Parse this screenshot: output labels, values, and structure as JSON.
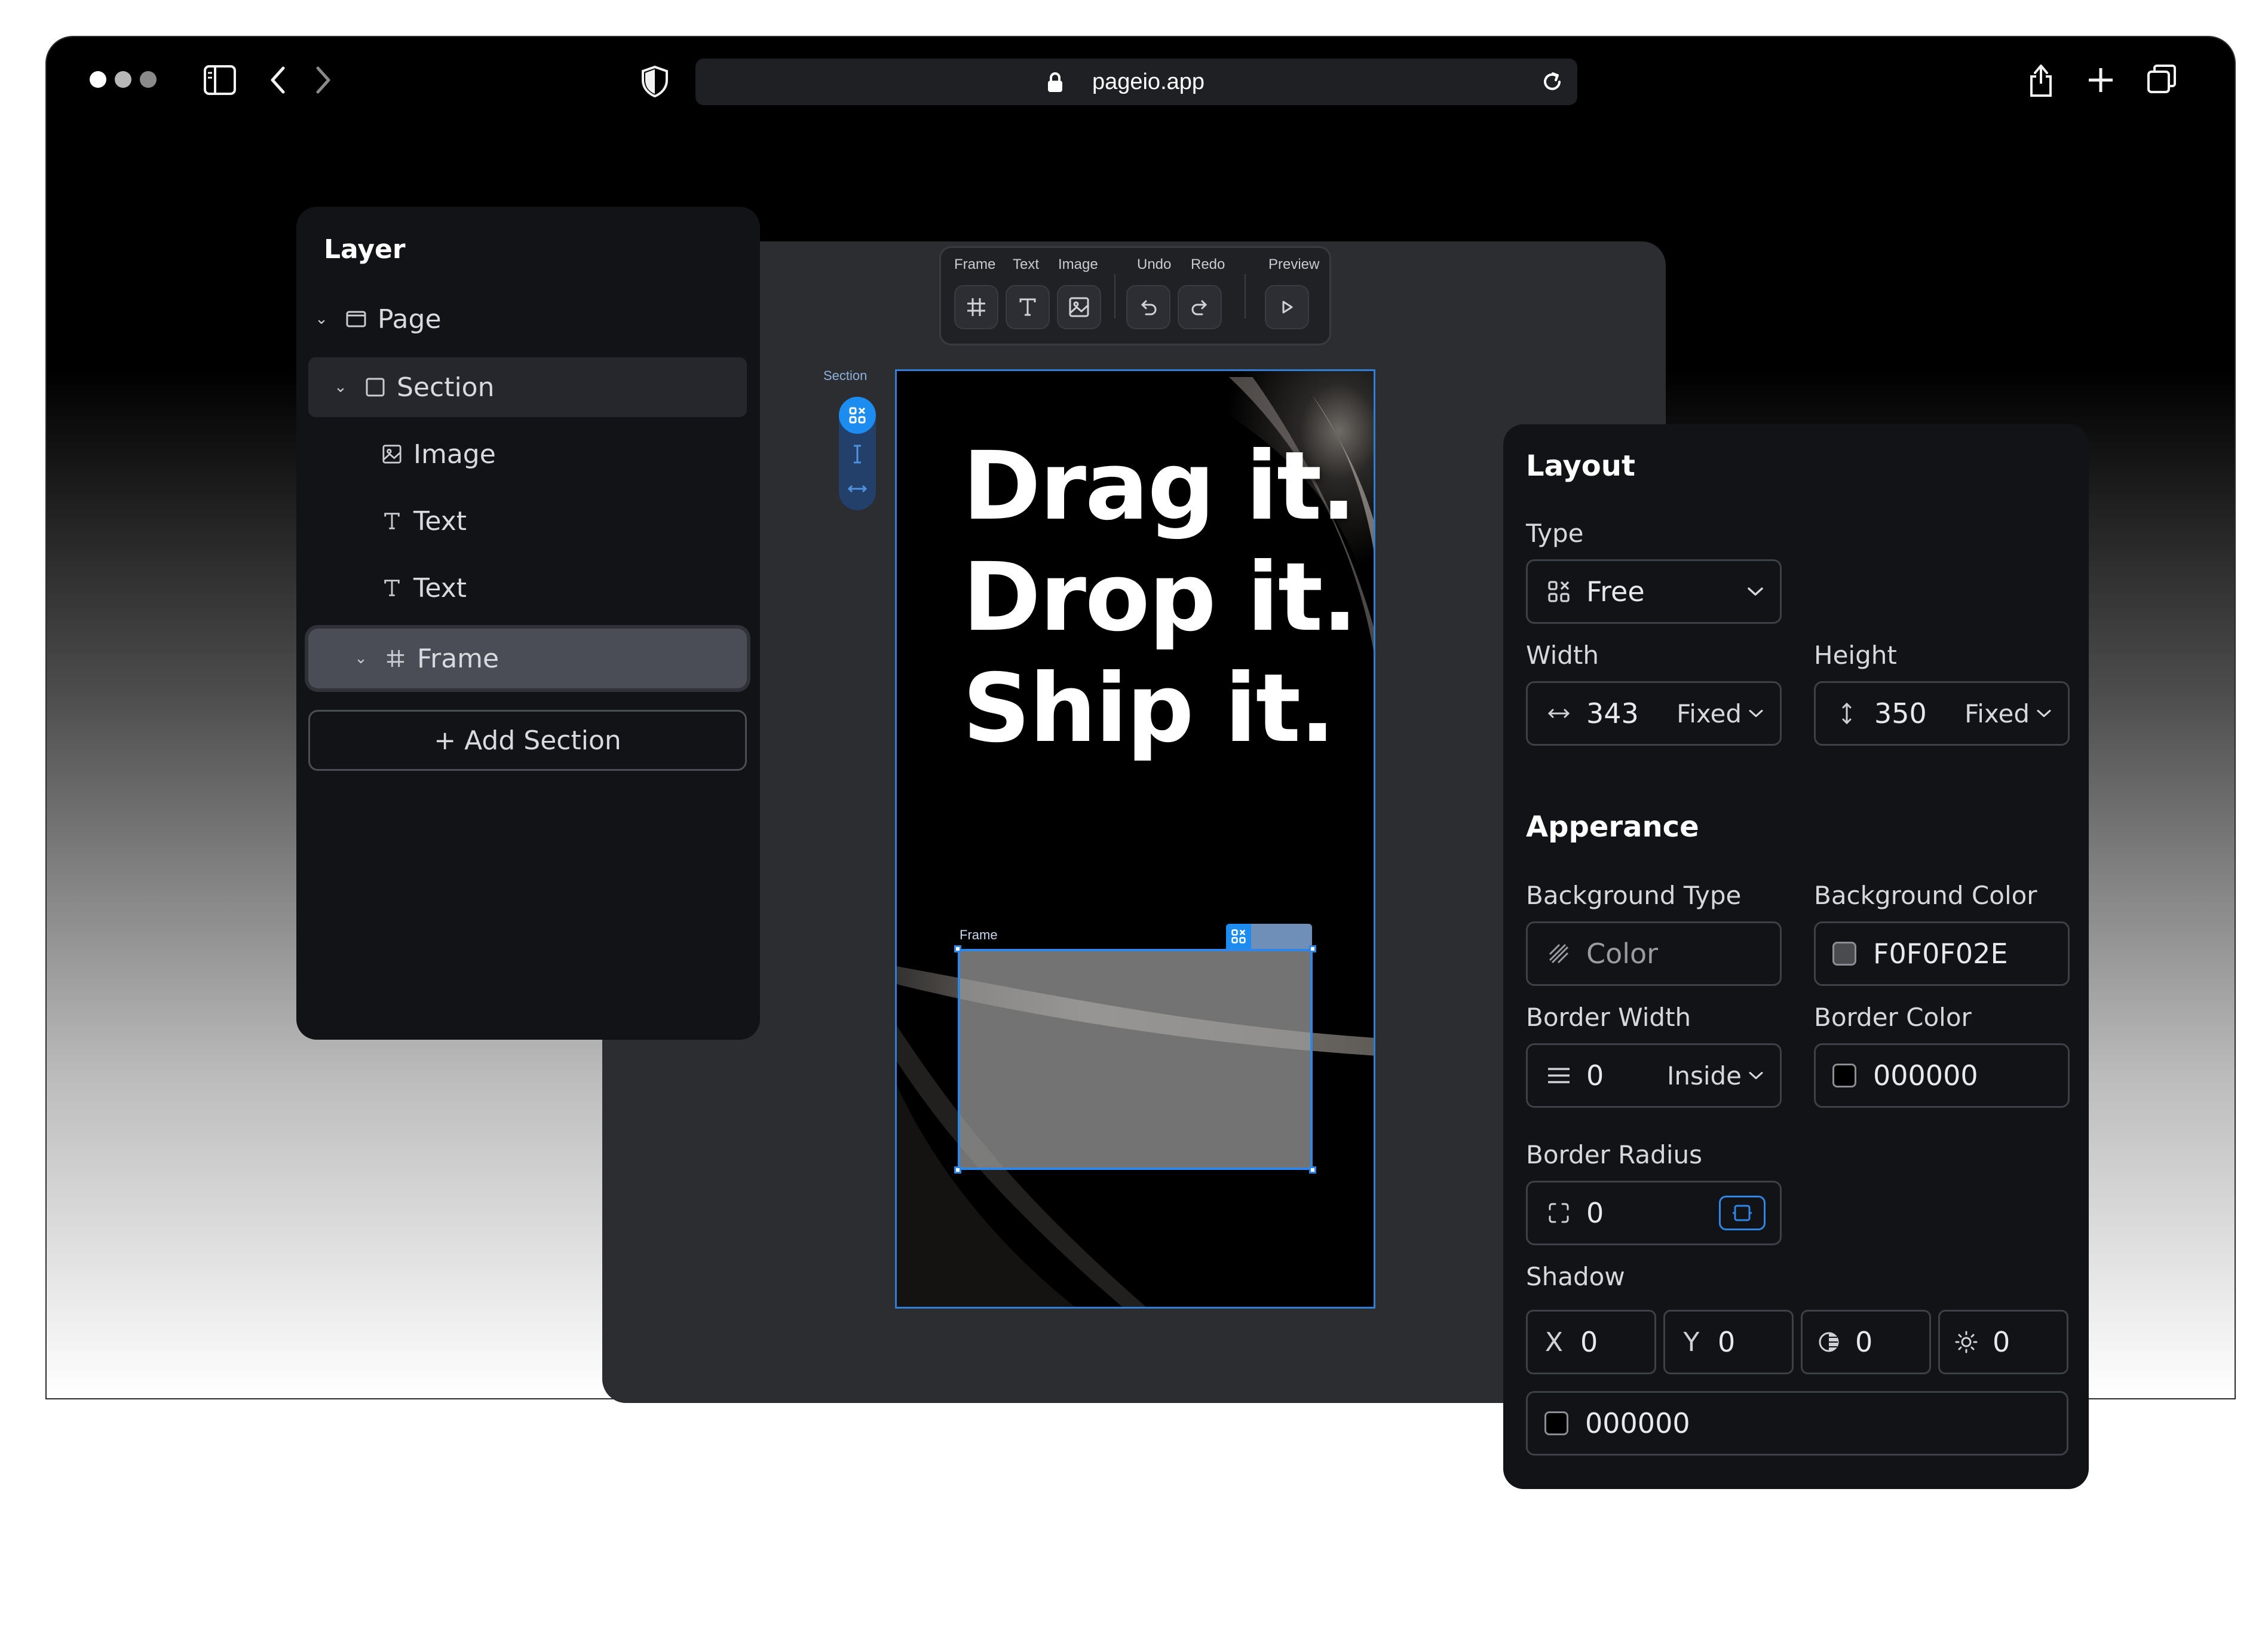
{
  "browser": {
    "url": "pageio.app",
    "traffic_light_colors": [
      "#ffffff",
      "#b8b8b8",
      "#8a8a8a"
    ]
  },
  "toolbar": {
    "frame_label": "Frame",
    "text_label": "Text",
    "image_label": "Image",
    "undo_label": "Undo",
    "redo_label": "Redo",
    "preview_label": "Preview"
  },
  "canvas": {
    "section_label": "Section",
    "frame_label": "Frame",
    "headline": [
      "Drag it.",
      "Drop it.",
      "Ship  it."
    ]
  },
  "layers": {
    "title": "Layer",
    "items": [
      {
        "label": "Page",
        "icon": "page-icon"
      },
      {
        "label": "Section",
        "icon": "section-icon"
      },
      {
        "label": "Image",
        "icon": "image-icon"
      },
      {
        "label": "Text",
        "icon": "text-icon"
      },
      {
        "label": "Text",
        "icon": "text-icon"
      },
      {
        "label": "Frame",
        "icon": "frame-icon"
      }
    ],
    "add_section": "+ Add Section"
  },
  "props": {
    "layout_title": "Layout",
    "type_label": "Type",
    "type_value": "Free",
    "width_label": "Width",
    "width_value": "343",
    "width_mode": "Fixed",
    "height_label": "Height",
    "height_value": "350",
    "height_mode": "Fixed",
    "appearance_title": "Apperance",
    "bg_type_label": "Background Type",
    "bg_type_value": "Color",
    "bg_color_label": "Background Color",
    "bg_color_value": "F0F0F02E",
    "border_width_label": "Border Width",
    "border_width_value": "0",
    "border_width_mode": "Inside",
    "border_color_label": "Border Color",
    "border_color_value": "000000",
    "border_radius_label": "Border Radius",
    "border_radius_value": "0",
    "shadow_label": "Shadow",
    "shadow_x_prefix": "X",
    "shadow_x": "0",
    "shadow_y_prefix": "Y",
    "shadow_y": "0",
    "shadow_blur": "0",
    "shadow_spread": "0",
    "shadow_color": "000000"
  },
  "colors": {
    "accent": "#2f86e6",
    "panel": "#121316",
    "canvas": "#2c2d31"
  }
}
